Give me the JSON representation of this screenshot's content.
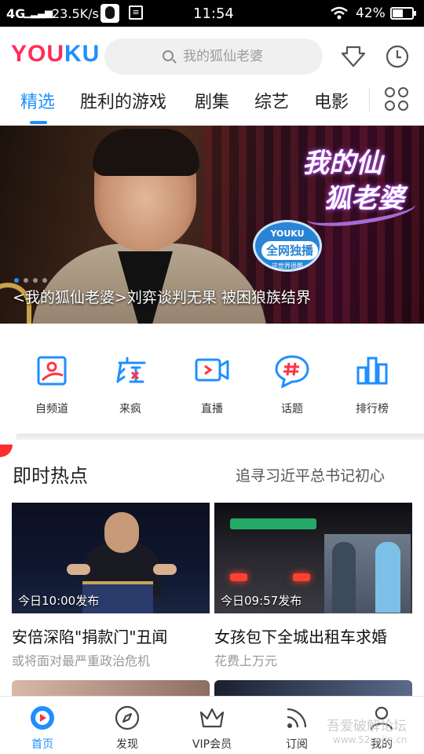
{
  "status_bar": {
    "signal": "4G",
    "speed": "23.5K/s",
    "time": "11:54",
    "battery": "42%"
  },
  "header": {
    "logo_part1": "YOU",
    "logo_part2": "KU",
    "search_placeholder": "我的狐仙老婆"
  },
  "tabs": [
    {
      "label": "精选",
      "active": true
    },
    {
      "label": "胜利的游戏"
    },
    {
      "label": "剧集"
    },
    {
      "label": "综艺"
    },
    {
      "label": "电影"
    }
  ],
  "banner": {
    "show_title_line1": "我的仙",
    "show_title_line2": "狐老婆",
    "badge_top": "YOUKU",
    "badge_main": "全网独播",
    "badge_bottom": "这世界很酷",
    "caption": "<我的狐仙老婆>刘弈谈判无果 被困狼族结界"
  },
  "quick_links": [
    {
      "label": "自频道",
      "icon": "self-channel-icon"
    },
    {
      "label": "来疯",
      "icon": "laifeng-icon"
    },
    {
      "label": "直播",
      "icon": "live-icon"
    },
    {
      "label": "话题",
      "icon": "topic-icon"
    },
    {
      "label": "排行榜",
      "icon": "ranking-icon"
    }
  ],
  "hot": {
    "title": "即时热点",
    "more": "追寻习近平总书记初心",
    "cards": [
      {
        "stamp": "今日10:00发布",
        "title": "安倍深陷\"捐款门\"丑闻",
        "subtitle": "或将面对最严重政治危机"
      },
      {
        "stamp": "今日09:57发布",
        "title": "女孩包下全城出租车求婚",
        "subtitle": "花费上万元"
      }
    ]
  },
  "bottom_nav": [
    {
      "label": "首页",
      "icon": "home-icon",
      "active": true
    },
    {
      "label": "发现",
      "icon": "compass-icon"
    },
    {
      "label": "VIP会员",
      "icon": "crown-icon"
    },
    {
      "label": "订阅",
      "icon": "rss-icon"
    },
    {
      "label": "我的",
      "icon": "user-icon"
    }
  ],
  "watermark": {
    "line1": "吾爱破解论坛",
    "line2": "www.52pojie.cn"
  },
  "colors": {
    "accent": "#1f8fff",
    "logo_red": "#ff2d55",
    "icon_red": "#ff3344"
  }
}
